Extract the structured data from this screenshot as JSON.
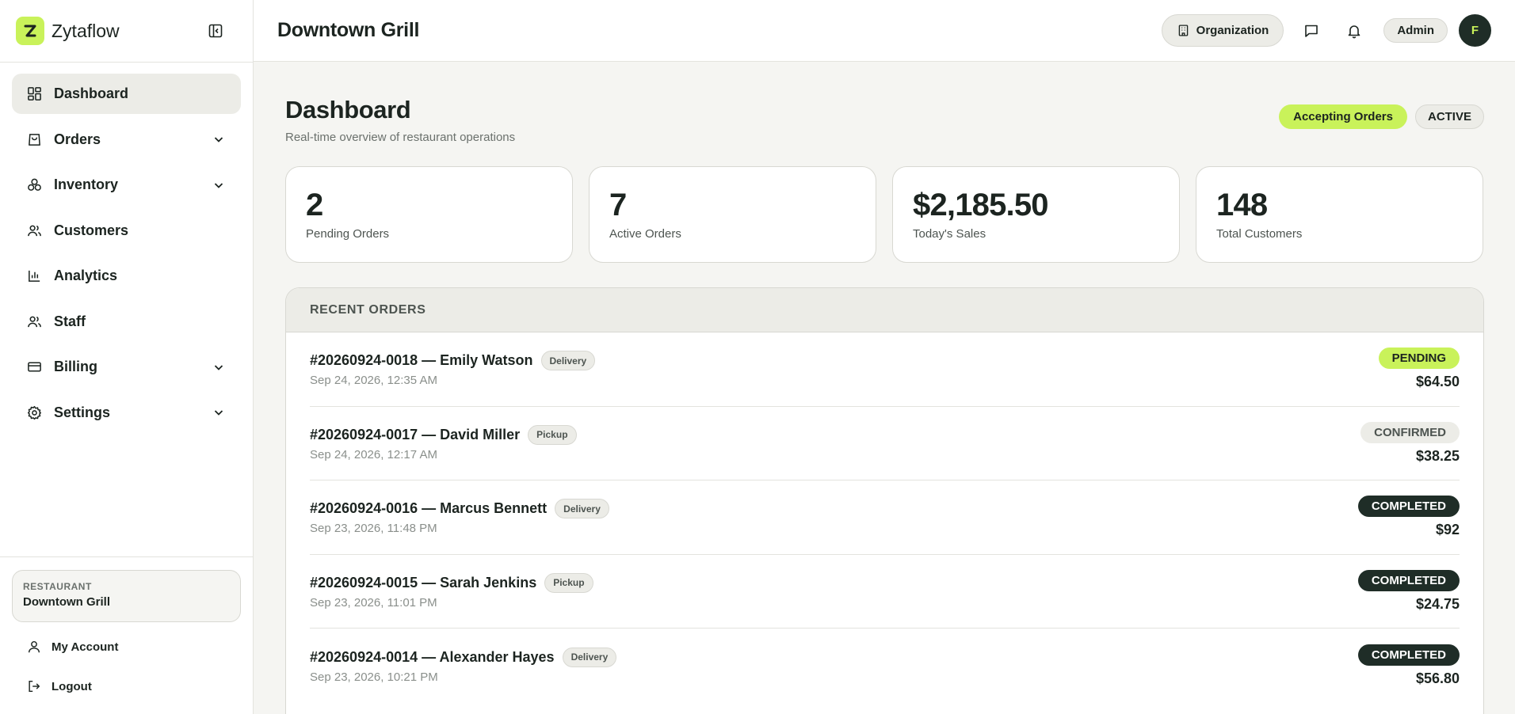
{
  "app": {
    "brand_name": "Zytaflow",
    "accent_color": "#c9f25a",
    "dark_color": "#1f2d27"
  },
  "sidebar": {
    "items": [
      {
        "label": "Dashboard",
        "icon": "dashboard-grid-icon",
        "active": true,
        "expandable": false
      },
      {
        "label": "Orders",
        "icon": "shopping-bag-icon",
        "active": false,
        "expandable": true
      },
      {
        "label": "Inventory",
        "icon": "boxes-icon",
        "active": false,
        "expandable": true
      },
      {
        "label": "Customers",
        "icon": "users-icon",
        "active": false,
        "expandable": false
      },
      {
        "label": "Analytics",
        "icon": "bar-chart-icon",
        "active": false,
        "expandable": false
      },
      {
        "label": "Staff",
        "icon": "users-icon",
        "active": false,
        "expandable": false
      },
      {
        "label": "Billing",
        "icon": "credit-card-icon",
        "active": false,
        "expandable": true
      },
      {
        "label": "Settings",
        "icon": "gear-icon",
        "active": false,
        "expandable": true
      }
    ],
    "restaurant_label": "RESTAURANT",
    "restaurant_name": "Downtown Grill",
    "my_account": "My Account",
    "logout": "Logout"
  },
  "header": {
    "title": "Downtown Grill",
    "organization": "Organization",
    "admin": "Admin",
    "avatar_initial": "F"
  },
  "page": {
    "title": "Dashboard",
    "subtitle": "Real-time overview of restaurant operations",
    "accepting_orders": "Accepting Orders",
    "status": "ACTIVE"
  },
  "stats": [
    {
      "value": "2",
      "label": "Pending Orders"
    },
    {
      "value": "7",
      "label": "Active Orders"
    },
    {
      "value": "$2,185.50",
      "label": "Today's Sales"
    },
    {
      "value": "148",
      "label": "Total Customers"
    }
  ],
  "recent_orders": {
    "heading": "RECENT ORDERS",
    "rows": [
      {
        "title": "#20260924-0018 — Emily Watson",
        "type": "Delivery",
        "date": "Sep 24, 2026, 12:35 AM",
        "status": "PENDING",
        "status_kind": "pending",
        "total": "$64.50"
      },
      {
        "title": "#20260924-0017 — David Miller",
        "type": "Pickup",
        "date": "Sep 24, 2026, 12:17 AM",
        "status": "CONFIRMED",
        "status_kind": "confirmed",
        "total": "$38.25"
      },
      {
        "title": "#20260924-0016 — Marcus Bennett",
        "type": "Delivery",
        "date": "Sep 23, 2026, 11:48 PM",
        "status": "COMPLETED",
        "status_kind": "completed",
        "total": "$92"
      },
      {
        "title": "#20260924-0015 — Sarah Jenkins",
        "type": "Pickup",
        "date": "Sep 23, 2026, 11:01 PM",
        "status": "COMPLETED",
        "status_kind": "completed",
        "total": "$24.75"
      },
      {
        "title": "#20260924-0014 — Alexander Hayes",
        "type": "Delivery",
        "date": "Sep 23, 2026, 10:21 PM",
        "status": "COMPLETED",
        "status_kind": "completed",
        "total": "$56.80"
      }
    ]
  }
}
